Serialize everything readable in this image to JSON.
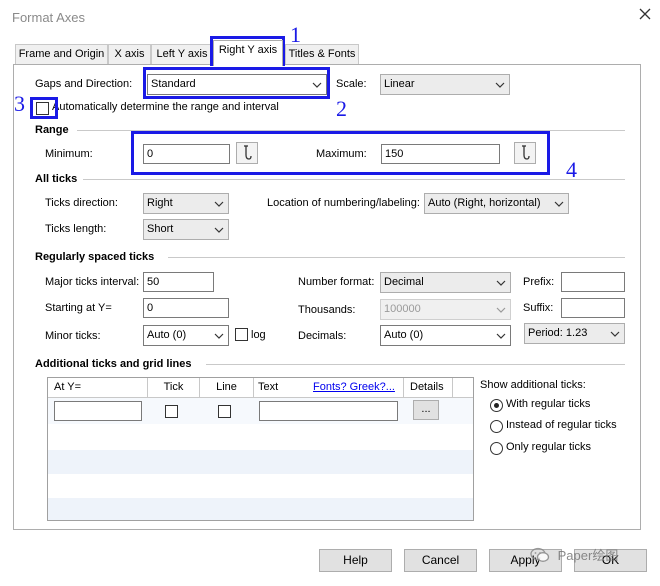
{
  "window": {
    "title": "Format Axes"
  },
  "tabs": [
    {
      "label": "Frame and Origin"
    },
    {
      "label": "X axis"
    },
    {
      "label": "Left Y axis"
    },
    {
      "label": "Right Y axis"
    },
    {
      "label": "Titles & Fonts"
    }
  ],
  "active_tab": "Right Y axis",
  "gaps": {
    "label": "Gaps and Direction:",
    "value": "Standard"
  },
  "scale": {
    "label": "Scale:",
    "value": "Linear"
  },
  "auto_range": {
    "label": "Automatically determine the range and interval",
    "checked": false
  },
  "range": {
    "heading": "Range",
    "min_label": "Minimum:",
    "min_value": "0",
    "max_label": "Maximum:",
    "max_value": "150"
  },
  "all_ticks": {
    "heading": "All ticks",
    "direction_label": "Ticks direction:",
    "direction_value": "Right",
    "location_label": "Location of numbering/labeling:",
    "location_value": "Auto (Right, horizontal)",
    "length_label": "Ticks length:",
    "length_value": "Short"
  },
  "regular_ticks": {
    "heading": "Regularly spaced ticks",
    "major_label": "Major ticks interval:",
    "major_value": "50",
    "start_label": "Starting at Y=",
    "start_value": "0",
    "minor_label": "Minor ticks:",
    "minor_value": "Auto (0)",
    "log_label": "log",
    "log_checked": false,
    "numformat_label": "Number format:",
    "numformat_value": "Decimal",
    "thousands_label": "Thousands:",
    "thousands_value": "100000",
    "decimals_label": "Decimals:",
    "decimals_value": "Auto (0)",
    "prefix_label": "Prefix:",
    "prefix_value": "",
    "suffix_label": "Suffix:",
    "suffix_value": "",
    "period_value": "Period: 1.23"
  },
  "additional": {
    "heading": "Additional ticks and grid lines",
    "columns": {
      "at_y": "At Y=",
      "tick": "Tick",
      "line": "Line",
      "text": "Text",
      "fonts_link": "Fonts? Greek?...",
      "details": "Details"
    },
    "ellipsis": "...",
    "show_label": "Show additional ticks:",
    "options": [
      "With regular ticks",
      "Instead of regular ticks",
      "Only regular ticks"
    ],
    "selected_option": 0
  },
  "buttons": {
    "help": "Help",
    "cancel": "Cancel",
    "apply": "Apply",
    "ok": "OK"
  },
  "annotations": [
    "1",
    "2",
    "3",
    "4"
  ],
  "watermark": "Paper绘图",
  "colors": {
    "annotation": "#1a1ae6",
    "link": "#0000ee"
  }
}
